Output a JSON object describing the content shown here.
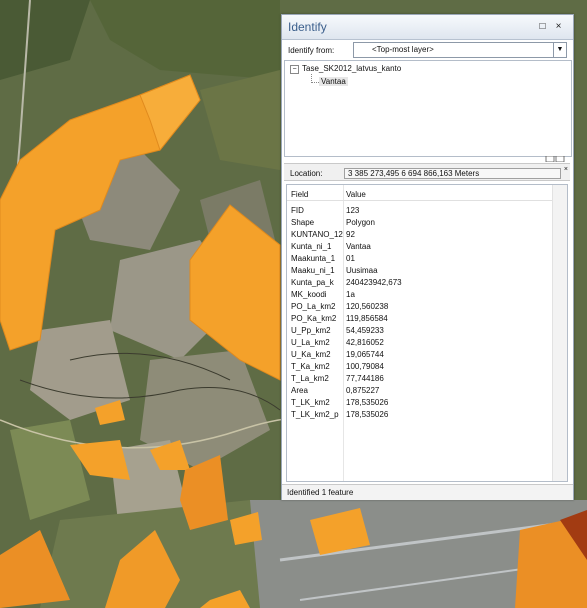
{
  "identify_window": {
    "title": "Identify",
    "identify_from_label": "Identify from:",
    "identify_from_value": "<Top-most layer>",
    "tree": {
      "layer": "Tase_SK2012_latvus_kanto",
      "feature": "Vantaa"
    },
    "location_label": "Location:",
    "location_value": "3 385 273,495  6 694 866,163 Meters",
    "grid_headers": {
      "field": "Field",
      "value": "Value"
    },
    "rows": [
      {
        "field": "FID",
        "value": "123"
      },
      {
        "field": "Shape",
        "value": "Polygon"
      },
      {
        "field": "KUNTANO_12",
        "value": "92"
      },
      {
        "field": "Kunta_ni_1",
        "value": "Vantaa"
      },
      {
        "field": "Maakunta_1",
        "value": "01"
      },
      {
        "field": "Maaku_ni_1",
        "value": "Uusimaa"
      },
      {
        "field": "Kunta_pa_k",
        "value": "240423942,673"
      },
      {
        "field": "MK_koodi",
        "value": "1a"
      },
      {
        "field": "PO_La_km2",
        "value": "120,560238"
      },
      {
        "field": "PO_Ka_km2",
        "value": "119,856584"
      },
      {
        "field": "U_Pp_km2",
        "value": "54,459233"
      },
      {
        "field": "U_La_km2",
        "value": "42,816052"
      },
      {
        "field": "U_Ka_km2",
        "value": "19,065744"
      },
      {
        "field": "T_Ka_km2",
        "value": "100,79084"
      },
      {
        "field": "T_La_km2",
        "value": "77,744186"
      },
      {
        "field": "Area",
        "value": "0,875227"
      },
      {
        "field": "T_LK_km2",
        "value": "178,535026"
      },
      {
        "field": "T_LK_km2_p",
        "value": "178,535026"
      }
    ],
    "status": "Identified 1 feature"
  },
  "map": {
    "background_color": "#5d6b42",
    "polygon_color": "#f4a12a",
    "polygon_dark_color": "#d9771a"
  }
}
